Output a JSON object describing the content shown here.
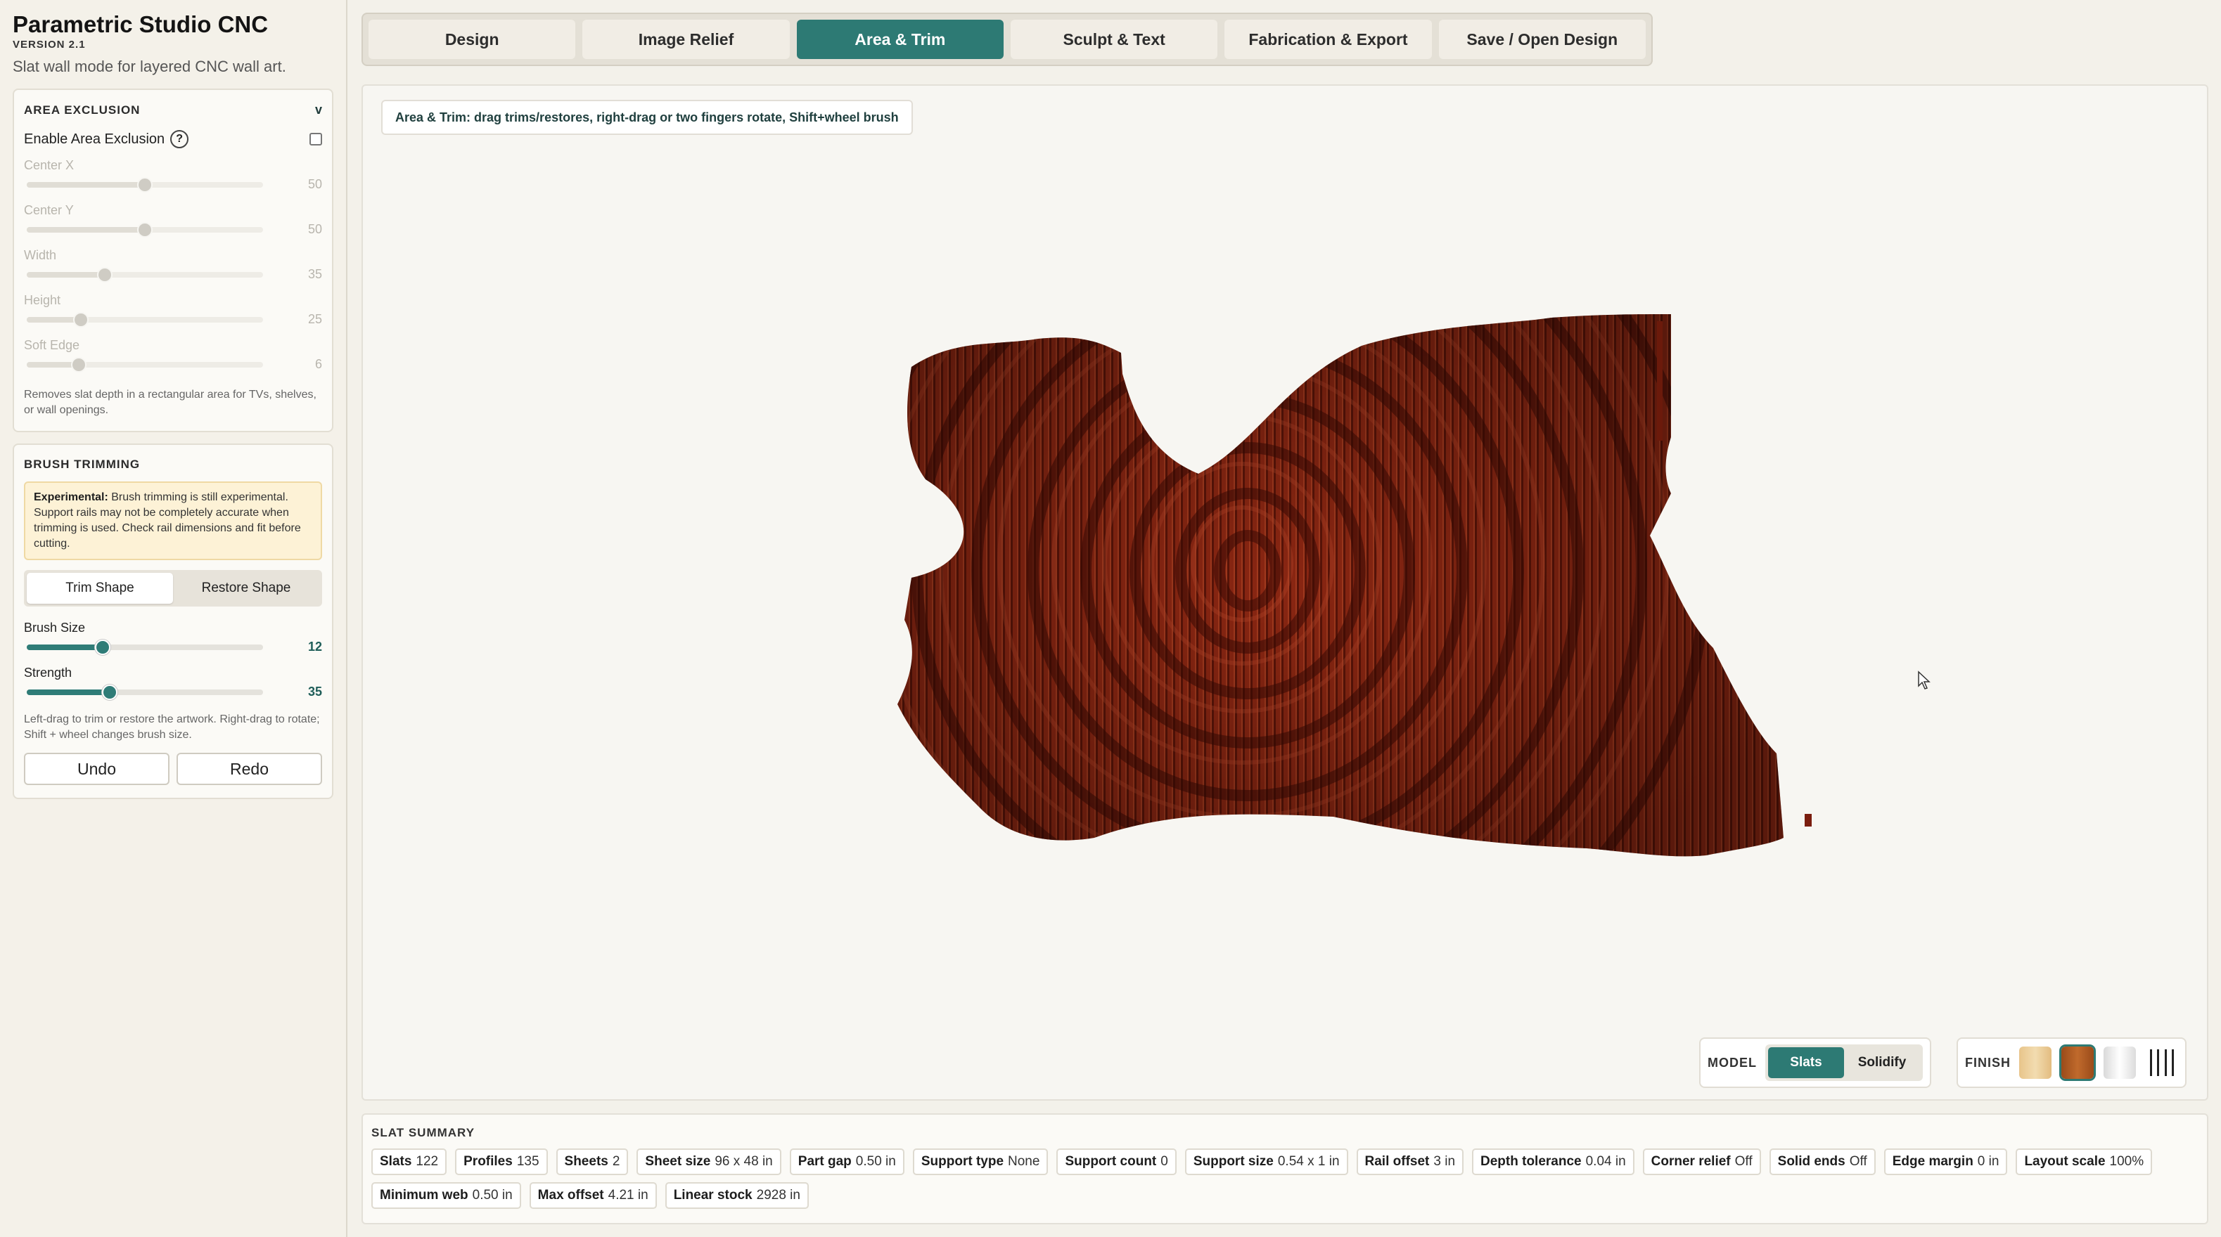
{
  "app": {
    "title": "Parametric Studio CNC",
    "version": "VERSION 2.1",
    "subtitle": "Slat wall mode for layered CNC wall art."
  },
  "tabs": [
    {
      "label": "Design",
      "active": false
    },
    {
      "label": "Image Relief",
      "active": false
    },
    {
      "label": "Area & Trim",
      "active": true
    },
    {
      "label": "Sculpt & Text",
      "active": false
    },
    {
      "label": "Fabrication & Export",
      "active": false
    },
    {
      "label": "Save / Open Design",
      "active": false
    }
  ],
  "area_exclusion": {
    "title": "AREA EXCLUSION",
    "collapse_glyph": "v",
    "enable_label": "Enable Area Exclusion",
    "help_glyph": "?",
    "enabled": false,
    "sliders": [
      {
        "label": "Center X",
        "value": "50",
        "fraction": 0.5
      },
      {
        "label": "Center Y",
        "value": "50",
        "fraction": 0.5
      },
      {
        "label": "Width",
        "value": "35",
        "fraction": 0.33
      },
      {
        "label": "Height",
        "value": "25",
        "fraction": 0.23
      },
      {
        "label": "Soft Edge",
        "value": "6",
        "fraction": 0.22
      }
    ],
    "note": "Removes slat depth in a rectangular area for TVs, shelves, or wall openings."
  },
  "brush_trimming": {
    "title": "BRUSH TRIMMING",
    "warning_bold": "Experimental:",
    "warning_text": " Brush trimming is still experimental. Support rails may not be completely accurate when trimming is used. Check rail dimensions and fit before cutting.",
    "mode_options": [
      "Trim Shape",
      "Restore Shape"
    ],
    "mode_selected": "Trim Shape",
    "brush_size": {
      "label": "Brush Size",
      "value": "12",
      "fraction": 0.32
    },
    "strength": {
      "label": "Strength",
      "value": "35",
      "fraction": 0.35
    },
    "note": "Left-drag to trim or restore the artwork. Right-drag to rotate; Shift + wheel changes brush size.",
    "undo_label": "Undo",
    "redo_label": "Redo"
  },
  "viewport": {
    "hint": "Area & Trim: drag trims/restores, right-drag or two fingers rotate, Shift+wheel brush"
  },
  "model_toggle": {
    "label": "MODEL",
    "options": [
      "Slats",
      "Solidify"
    ],
    "selected": "Slats"
  },
  "finish": {
    "label": "FINISH",
    "swatches": [
      "maple",
      "walnut",
      "white",
      "slat-lines-icon"
    ],
    "selected": "walnut"
  },
  "summary": {
    "title": "SLAT SUMMARY",
    "items": [
      {
        "key": "Slats",
        "value": "122"
      },
      {
        "key": "Profiles",
        "value": "135"
      },
      {
        "key": "Sheets",
        "value": "2"
      },
      {
        "key": "Sheet size",
        "value": "96 x 48 in"
      },
      {
        "key": "Part gap",
        "value": "0.50 in"
      },
      {
        "key": "Support type",
        "value": "None"
      },
      {
        "key": "Support count",
        "value": "0"
      },
      {
        "key": "Support size",
        "value": "0.54 x 1 in"
      },
      {
        "key": "Rail offset",
        "value": "3 in"
      },
      {
        "key": "Depth tolerance",
        "value": "0.04 in"
      },
      {
        "key": "Corner relief",
        "value": "Off"
      },
      {
        "key": "Solid ends",
        "value": "Off"
      },
      {
        "key": "Edge margin",
        "value": "0 in"
      },
      {
        "key": "Layout scale",
        "value": "100%"
      },
      {
        "key": "Minimum web",
        "value": "0.50 in"
      },
      {
        "key": "Max offset",
        "value": "4.21 in"
      },
      {
        "key": "Linear stock",
        "value": "2928 in"
      }
    ]
  },
  "colors": {
    "accent": "#2d7a74",
    "model_wood": "#7a1d0e"
  }
}
